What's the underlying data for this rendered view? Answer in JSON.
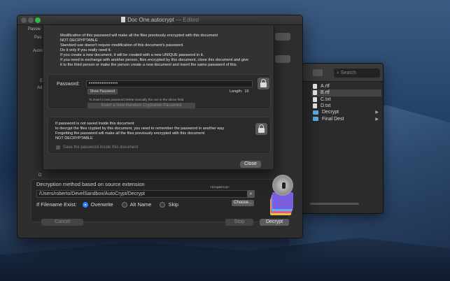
{
  "window": {
    "title": "Doc One.autocrypt",
    "edited": "— Edited"
  },
  "background_fragments": {
    "passw": "Passw",
    "pas": "Pas",
    "autocr": "Autocr",
    "ad": "Ad",
    "e": "E",
    "decrypt_section": "D"
  },
  "finder": {
    "search_placeholder": "Search",
    "items": [
      {
        "name": "A.rtf",
        "type": "file"
      },
      {
        "name": "B.rtf",
        "type": "file",
        "selected": true
      },
      {
        "name": "C.txt",
        "type": "file"
      },
      {
        "name": "D.txt",
        "type": "file"
      },
      {
        "name": "Decrypt",
        "type": "folder"
      },
      {
        "name": "Final Dest",
        "type": "folder"
      }
    ]
  },
  "sheet": {
    "info_lines": [
      "Modification of this password will make all the files previously encrypted with this document",
      "NOT DECRYPTABLE",
      "Standard use doesn't require modification of this document's password.",
      "Do it only if you really need it.",
      "If you create a new document, it will be created with a new UNIQUE password in it.",
      "If you need to exchange with another person, files encrypted by this document, clone this document and give",
      "it to the third person or make the person create a new document and insert the same password of this."
    ],
    "password_label": "Password:",
    "password_value": "••••••••••••••••",
    "show_password": "Show Password",
    "length_label": "Length:",
    "length_value": "16",
    "hint": "To insert a new password delete manually the one in the above field",
    "generate_button": "Insert a New Random Cryptation Password",
    "warning_lines": [
      "If password is not saved inside this document",
      "to decrypt the files crypted by this document, you need to remember the password in another way",
      "Forgetting the password will make all the files previously encrypted with this document",
      "NOT DECRYPTABLE"
    ],
    "save_checkbox": "Save the password inside this document",
    "close_button": "Close"
  },
  "decrypt": {
    "section_title": "Decryption method based on source extension",
    "path": "/Users/roberto/DevelSandbox/AutoCrypt/Decrypt",
    "drag_hint": "<Drag&Drop>",
    "choose_button": "Choose...",
    "if_exist_label": "If Filename Exist:",
    "options": [
      {
        "label": "Overwrite",
        "selected": true
      },
      {
        "label": "Alt Name",
        "selected": false
      },
      {
        "label": "Skip",
        "selected": false
      }
    ],
    "cancel_button": "Cancel",
    "stop_button": "Stop",
    "decrypt_button": "Decrypt"
  },
  "colors": {
    "accent": "#2a7fff",
    "window_bg": "#2e2e30",
    "sheet_bg": "#323234",
    "traffic_green": "#2ac240"
  },
  "icons": [
    "lock-icon",
    "search-icon",
    "app-lock-icon",
    "doc-icon",
    "folder-icon",
    "file-icon"
  ]
}
